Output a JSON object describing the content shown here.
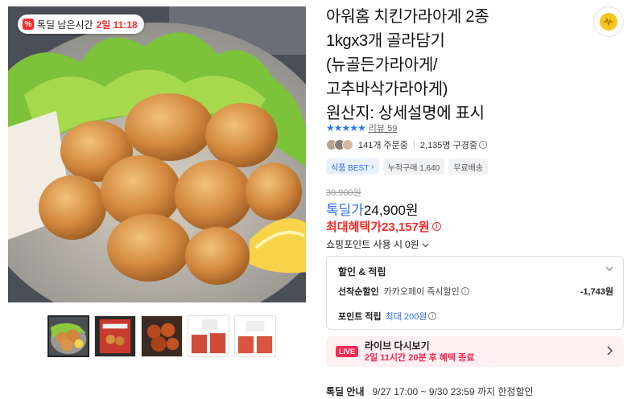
{
  "timer_badge": {
    "icon": "percent-badge-icon",
    "label": "톡딜 남은시간",
    "time": "2일 11:18"
  },
  "product": {
    "title_lines": [
      "아워홈 치킨가라아게 2종",
      "1kgx3개 골라담기",
      "(뉴골든가라아게/",
      "고추바삭가라아게)",
      "원산지: 상세설명에 표시"
    ],
    "rating_stars": "★★★★★",
    "review_label": "리뷰 59",
    "orders": "141개 주문중",
    "subscribers": "2,135명 구경중",
    "tags": [
      "식품 BEST",
      "누적구매 1,640",
      "무료배송"
    ],
    "original_price": "30,900원",
    "sale_label": "톡딜가",
    "sale_price": "24,900원",
    "max_benefit_label": "최대혜택가",
    "max_benefit_price": "23,157원",
    "shopping_point": "쇼핑포인트 사용 시",
    "shopping_point_value": "0원"
  },
  "benefit": {
    "title": "할인 & 적립",
    "first_discount_label": "선착순할인",
    "first_discount_desc": "카카오페이 즉시할인",
    "first_discount_amount": "-1,743원",
    "point_label": "포인트 적립",
    "point_value": "최대 200원"
  },
  "live": {
    "badge": "LIVE",
    "title": "라이브 다시보기",
    "subtitle": "2일 11시간 20분 후 혜택 종료"
  },
  "notice": {
    "label": "톡딜 안내",
    "period": "9/27 17:00 ~ 9/30 23:59 까지 한정할인"
  },
  "colors": {
    "accent_red": "#fa2828",
    "accent_blue": "#2a6ee8",
    "live_pink": "#fa2852"
  }
}
